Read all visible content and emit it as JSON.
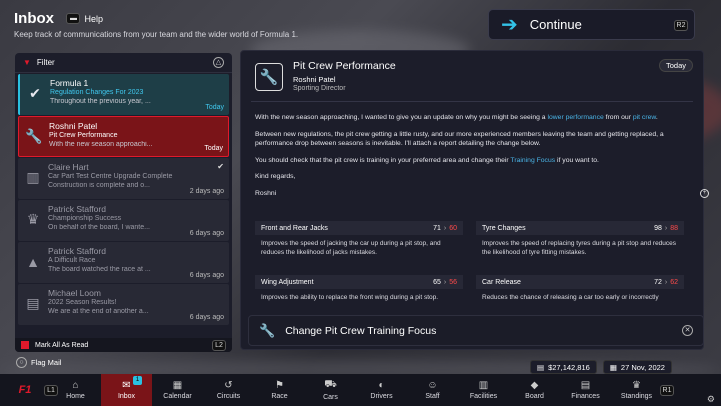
{
  "header": {
    "title": "Inbox",
    "help_label": "Help",
    "subtitle": "Keep track of communications from your team and the wider world of Formula 1."
  },
  "continue": {
    "label": "Continue",
    "key": "R2"
  },
  "filter": {
    "label": "Filter",
    "key": "△"
  },
  "inbox": [
    {
      "sender": "Formula 1",
      "topic": "Regulation Changes For 2023",
      "preview": "Throughout the previous year, ...",
      "date": "Today",
      "icon": "check-circle-icon",
      "state": "unread"
    },
    {
      "sender": "Roshni Patel",
      "topic": "Pit Crew Performance",
      "preview": "With the new season approachi...",
      "date": "Today",
      "icon": "wrench-icon",
      "state": "selected"
    },
    {
      "sender": "Claire Hart",
      "topic": "Car Part Test Centre Upgrade Complete",
      "preview": "Construction is complete and o...",
      "date": "2 days ago",
      "icon": "building-icon",
      "state": "read",
      "checked": true
    },
    {
      "sender": "Patrick Stafford",
      "topic": "Championship Success",
      "preview": "On behalf of the board, I wante...",
      "date": "6 days ago",
      "icon": "trophy-icon",
      "state": "read"
    },
    {
      "sender": "Patrick Stafford",
      "topic": "A Difficult Race",
      "preview": "The board watched the race at ...",
      "date": "6 days ago",
      "icon": "cone-icon",
      "state": "read"
    },
    {
      "sender": "Michael Loom",
      "topic": "2022 Season Results!",
      "preview": "We are at the end of another a...",
      "date": "6 days ago",
      "icon": "document-icon",
      "state": "read"
    }
  ],
  "mark_all_read": {
    "label": "Mark All As Read",
    "key": "L2"
  },
  "flag_mail": {
    "label": "Flag Mail"
  },
  "message": {
    "title": "Pit Crew Performance",
    "from": "Roshni Patel",
    "role": "Sporting Director",
    "date": "Today",
    "p1_a": "With the new season approaching, I wanted to give you an update on why you might be seeing a ",
    "p1_hl1": "lower performance",
    "p1_b": " from our ",
    "p1_hl2": "pit crew",
    "p1_c": ".",
    "p2": "Between new regulations, the pit crew getting a little rusty, and our more experienced members leaving the team and getting replaced, a performance drop between seasons is inevitable. I'll attach a report detailing the change below.",
    "p3_a": "You should check that the pit crew is training in your preferred area and change their ",
    "p3_hl": "Training Focus",
    "p3_b": " if you want to.",
    "p4": "Kind regards,",
    "p5": "Roshni"
  },
  "stats": [
    {
      "name": "Front and Rear Jacks",
      "old": "71",
      "new": "60",
      "desc": "Improves the speed of jacking the car up during a pit stop, and reduces the likelihood of jacks mistakes."
    },
    {
      "name": "Tyre Changes",
      "old": "98",
      "new": "88",
      "desc": "Improves the speed of replacing tyres during a pit stop and reduces the likelihood of tyre fitting mistakes."
    },
    {
      "name": "Wing Adjustment",
      "old": "65",
      "new": "56",
      "desc": "Improves the ability to replace the front wing during a pit stop."
    },
    {
      "name": "Car Release",
      "old": "72",
      "new": "62",
      "desc": "Reduces the chance of releasing a car too early or incorrectly"
    }
  ],
  "change_focus": {
    "label": "Change Pit Crew Training Focus",
    "key": "✕"
  },
  "info": {
    "money": "$27,142,816",
    "date": "27 Nov, 2022"
  },
  "nav": {
    "left_key": "L1",
    "right_key": "R1",
    "items": [
      {
        "label": "Home",
        "icon": "home-icon"
      },
      {
        "label": "Inbox",
        "icon": "mail-icon",
        "badge": "1",
        "active": true
      },
      {
        "label": "Calendar",
        "icon": "calendar-icon"
      },
      {
        "label": "Circuits",
        "icon": "circuit-icon"
      },
      {
        "label": "Race",
        "icon": "flag-icon"
      },
      {
        "label": "Cars",
        "icon": "car-icon"
      },
      {
        "label": "Drivers",
        "icon": "helmet-icon"
      },
      {
        "label": "Staff",
        "icon": "staff-icon"
      },
      {
        "label": "Facilities",
        "icon": "facilities-icon"
      },
      {
        "label": "Board",
        "icon": "board-icon"
      },
      {
        "label": "Finances",
        "icon": "finances-icon"
      },
      {
        "label": "Standings",
        "icon": "trophy-icon"
      }
    ]
  },
  "colors": {
    "accent": "#e0192b",
    "highlight": "#4ab4e6",
    "unread": "#2ac0e0"
  }
}
